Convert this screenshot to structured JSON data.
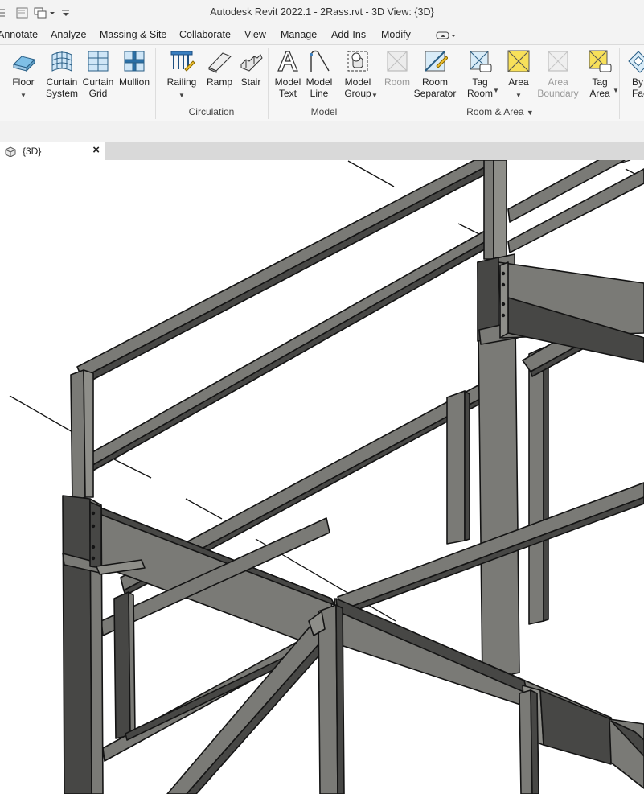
{
  "window": {
    "title": "Autodesk Revit 2022.1 - 2Rass.rvt - 3D View: {3D}"
  },
  "ribbon_tabs": [
    {
      "label": "Annotate"
    },
    {
      "label": "Analyze"
    },
    {
      "label": "Massing & Site"
    },
    {
      "label": "Collaborate"
    },
    {
      "label": "View"
    },
    {
      "label": "Manage"
    },
    {
      "label": "Add-Ins"
    },
    {
      "label": "Modify"
    }
  ],
  "ribbon": {
    "build": {
      "floor": "Floor",
      "curtain_system": "Curtain\nSystem",
      "curtain_grid": "Curtain\nGrid",
      "mullion": "Mullion"
    },
    "circulation": {
      "label": "Circulation",
      "railing": "Railing",
      "ramp": "Ramp",
      "stair": "Stair"
    },
    "model": {
      "label": "Model",
      "model_text": "Model\nText",
      "model_line": "Model\nLine",
      "model_group": "Model\nGroup"
    },
    "room_area": {
      "label": "Room & Area",
      "room": "Room",
      "room_separator": "Room\nSeparator",
      "tag_room": "Tag\nRoom",
      "area": "Area",
      "area_boundary": "Area\nBoundary",
      "tag_area": "Tag\nArea"
    },
    "opening": {
      "by_face": "By\nFace"
    }
  },
  "view_tab": {
    "label": "{3D}"
  },
  "colors": {
    "steel_face": "#7a7a76",
    "steel_dark": "#474745",
    "steel_light": "#8e8e89",
    "edge": "#141414",
    "area_yellow": "#f7e05a"
  }
}
